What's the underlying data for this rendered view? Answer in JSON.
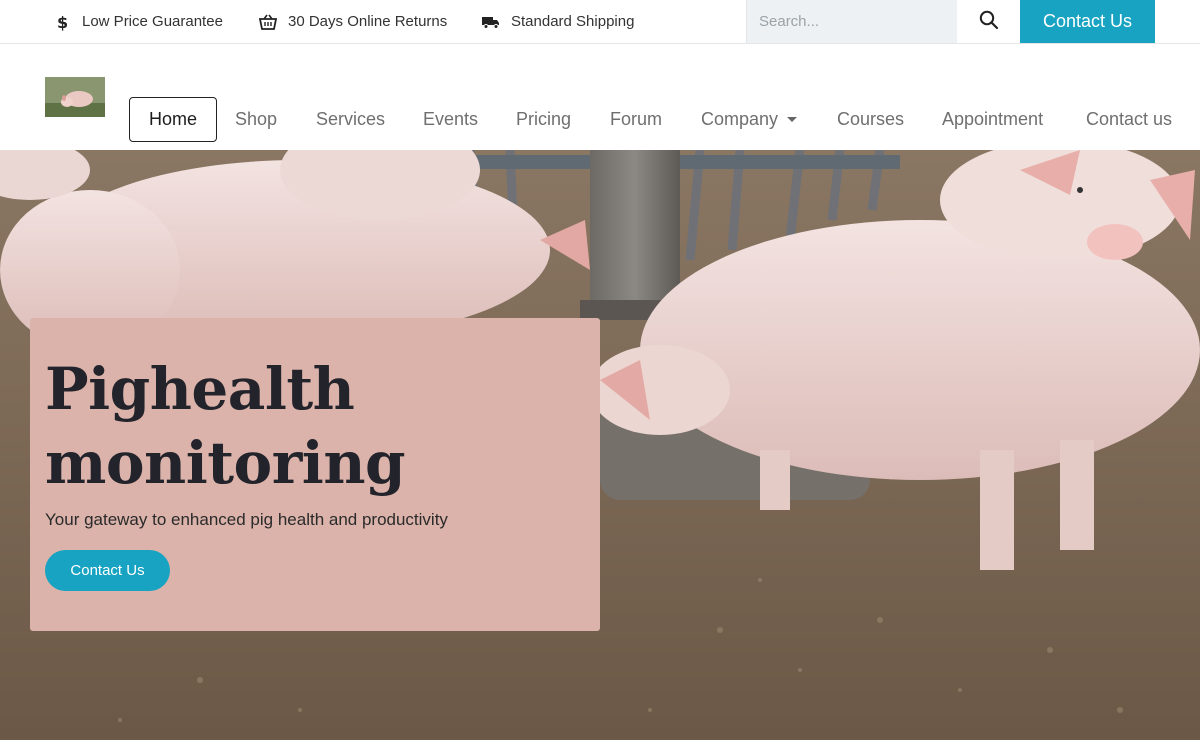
{
  "topbar": {
    "promos": [
      {
        "icon": "dollar-icon",
        "label": "Low Price Guarantee"
      },
      {
        "icon": "basket-icon",
        "label": "30 Days Online Returns"
      },
      {
        "icon": "truck-icon",
        "label": "Standard Shipping"
      }
    ],
    "search": {
      "placeholder": "Search...",
      "value": ""
    },
    "contact_label": "Contact Us"
  },
  "nav": {
    "items": [
      {
        "label": "Home",
        "active": true
      },
      {
        "label": "Shop"
      },
      {
        "label": "Services"
      },
      {
        "label": "Events"
      },
      {
        "label": "Pricing"
      },
      {
        "label": "Forum"
      },
      {
        "label": "Company",
        "dropdown": true
      },
      {
        "label": "Courses"
      },
      {
        "label": "Appointment"
      },
      {
        "label": "Contact us"
      }
    ]
  },
  "hero": {
    "title": "Pighealth monitoring",
    "subtitle": "Your gateway to enhanced pig health and productivity",
    "cta_label": "Contact Us"
  },
  "colors": {
    "accent": "#17a3c1",
    "card": "#dbb3aa",
    "title_text": "#22232b"
  }
}
